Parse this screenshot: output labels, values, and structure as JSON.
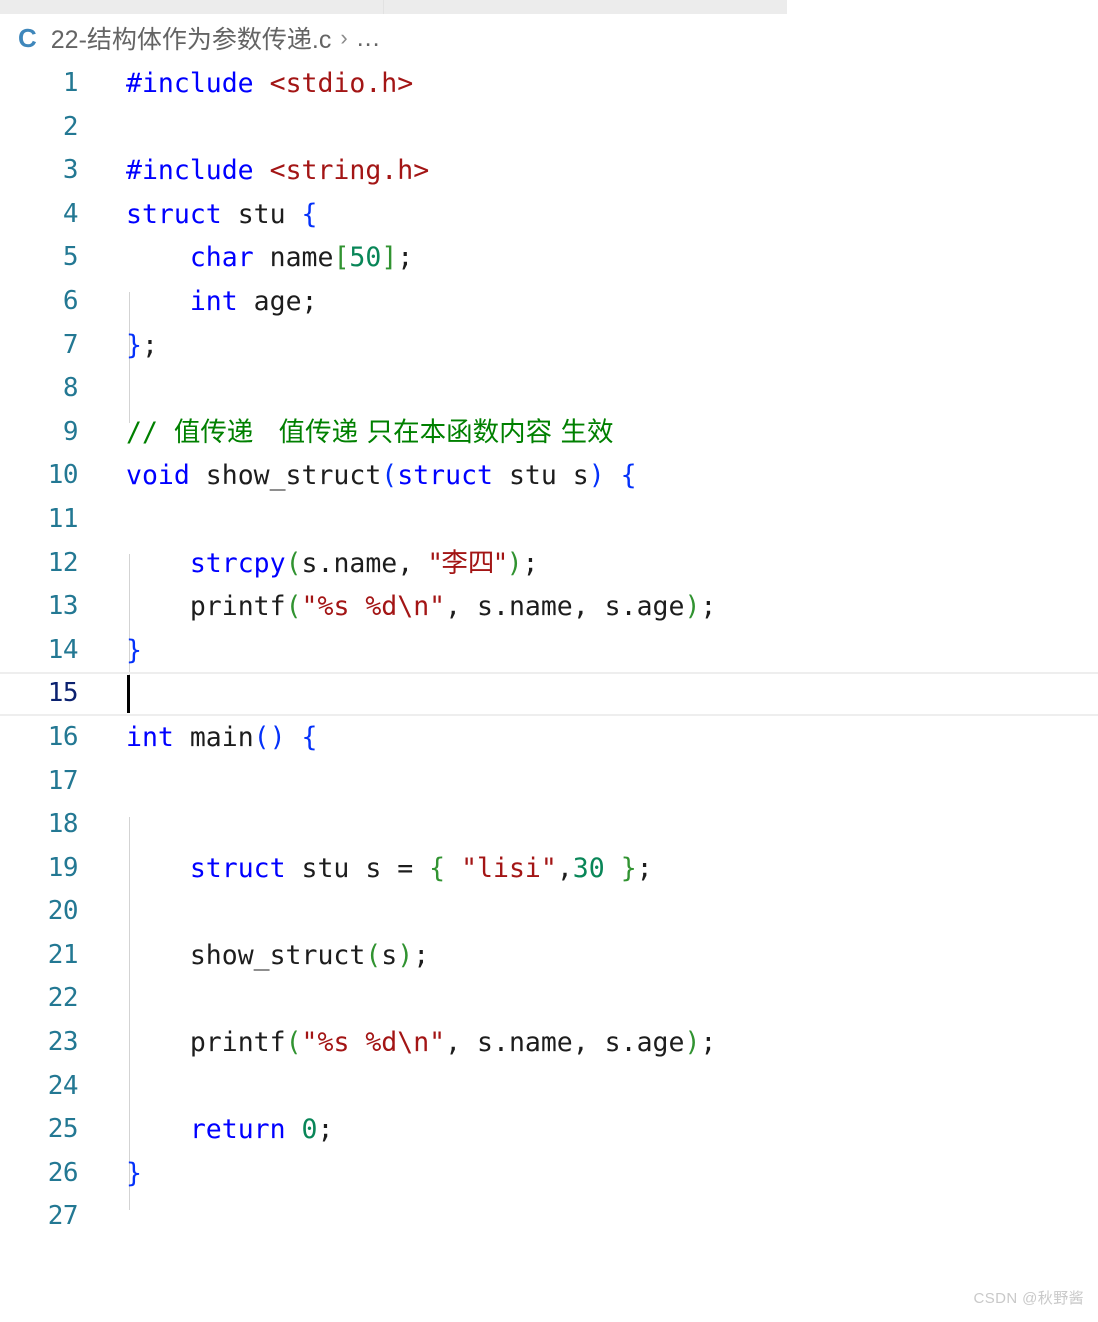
{
  "window": {
    "app": "code-editor",
    "theme": "light"
  },
  "tabstrip": {
    "visible": true
  },
  "breadcrumb": {
    "file_icon": "c-file-icon",
    "file_icon_label": "C",
    "file_name": "22-结构体作为参数传递.c",
    "separator": "›",
    "overflow": "..."
  },
  "editor": {
    "language": "c",
    "active_line": 15,
    "cursor": {
      "line": 15,
      "column": 1
    },
    "total_lines": 27,
    "lines": [
      {
        "n": "1",
        "tokens": [
          {
            "t": "#include",
            "c": "tk-pre"
          },
          {
            "t": " ",
            "c": "tk-plain"
          },
          {
            "t": "<stdio.h>",
            "c": "tk-str"
          }
        ]
      },
      {
        "n": "2",
        "tokens": []
      },
      {
        "n": "3",
        "tokens": [
          {
            "t": "#include",
            "c": "tk-pre"
          },
          {
            "t": " ",
            "c": "tk-plain"
          },
          {
            "t": "<string.h>",
            "c": "tk-str"
          }
        ]
      },
      {
        "n": "4",
        "tokens": [
          {
            "t": "struct",
            "c": "tk-key"
          },
          {
            "t": " stu ",
            "c": "tk-plain"
          },
          {
            "t": "{",
            "c": "tk-br1"
          }
        ]
      },
      {
        "n": "5",
        "tokens": [
          {
            "t": "    ",
            "c": "tk-plain"
          },
          {
            "t": "char",
            "c": "tk-key"
          },
          {
            "t": " name",
            "c": "tk-plain"
          },
          {
            "t": "[",
            "c": "tk-br2"
          },
          {
            "t": "50",
            "c": "tk-num"
          },
          {
            "t": "]",
            "c": "tk-br2"
          },
          {
            "t": ";",
            "c": "tk-plain"
          }
        ]
      },
      {
        "n": "6",
        "tokens": [
          {
            "t": "    ",
            "c": "tk-plain"
          },
          {
            "t": "int",
            "c": "tk-key"
          },
          {
            "t": " age;",
            "c": "tk-plain"
          }
        ]
      },
      {
        "n": "7",
        "tokens": [
          {
            "t": "}",
            "c": "tk-br1"
          },
          {
            "t": ";",
            "c": "tk-plain"
          }
        ]
      },
      {
        "n": "8",
        "tokens": []
      },
      {
        "n": "9",
        "tokens": [
          {
            "t": "// ",
            "c": "tk-cmt"
          },
          {
            "t": "值传递   值传递 只在本函数内容 生效",
            "c": "tk-cmt cjk"
          }
        ]
      },
      {
        "n": "10",
        "tokens": [
          {
            "t": "void",
            "c": "tk-key"
          },
          {
            "t": " show_struct",
            "c": "tk-fn"
          },
          {
            "t": "(",
            "c": "tk-br1"
          },
          {
            "t": "struct",
            "c": "tk-key"
          },
          {
            "t": " stu s",
            "c": "tk-plain"
          },
          {
            "t": ")",
            "c": "tk-br1"
          },
          {
            "t": " ",
            "c": "tk-plain"
          },
          {
            "t": "{",
            "c": "tk-br1"
          }
        ]
      },
      {
        "n": "11",
        "tokens": []
      },
      {
        "n": "12",
        "tokens": [
          {
            "t": "    ",
            "c": "tk-plain"
          },
          {
            "t": "strcpy",
            "c": "tk-fnblue"
          },
          {
            "t": "(",
            "c": "tk-br2"
          },
          {
            "t": "s.name, ",
            "c": "tk-plain"
          },
          {
            "t": "\"李四\"",
            "c": "tk-str cjk"
          },
          {
            "t": ")",
            "c": "tk-br2"
          },
          {
            "t": ";",
            "c": "tk-plain"
          }
        ]
      },
      {
        "n": "13",
        "tokens": [
          {
            "t": "    ",
            "c": "tk-plain"
          },
          {
            "t": "printf",
            "c": "tk-fn"
          },
          {
            "t": "(",
            "c": "tk-br2"
          },
          {
            "t": "\"%s %d\\n\"",
            "c": "tk-str"
          },
          {
            "t": ", s.name, s.age",
            "c": "tk-plain"
          },
          {
            "t": ")",
            "c": "tk-br2"
          },
          {
            "t": ";",
            "c": "tk-plain"
          }
        ]
      },
      {
        "n": "14",
        "tokens": [
          {
            "t": "}",
            "c": "tk-br1"
          }
        ]
      },
      {
        "n": "15",
        "tokens": []
      },
      {
        "n": "16",
        "tokens": [
          {
            "t": "int",
            "c": "tk-key"
          },
          {
            "t": " main",
            "c": "tk-fn"
          },
          {
            "t": "()",
            "c": "tk-br1"
          },
          {
            "t": " ",
            "c": "tk-plain"
          },
          {
            "t": "{",
            "c": "tk-br1"
          }
        ]
      },
      {
        "n": "17",
        "tokens": []
      },
      {
        "n": "18",
        "tokens": []
      },
      {
        "n": "19",
        "tokens": [
          {
            "t": "    ",
            "c": "tk-plain"
          },
          {
            "t": "struct",
            "c": "tk-key"
          },
          {
            "t": " stu s = ",
            "c": "tk-plain"
          },
          {
            "t": "{",
            "c": "tk-br2"
          },
          {
            "t": " ",
            "c": "tk-plain"
          },
          {
            "t": "\"lisi\"",
            "c": "tk-str"
          },
          {
            "t": ",",
            "c": "tk-plain"
          },
          {
            "t": "30",
            "c": "tk-num"
          },
          {
            "t": " ",
            "c": "tk-plain"
          },
          {
            "t": "}",
            "c": "tk-br2"
          },
          {
            "t": ";",
            "c": "tk-plain"
          }
        ]
      },
      {
        "n": "20",
        "tokens": []
      },
      {
        "n": "21",
        "tokens": [
          {
            "t": "    ",
            "c": "tk-plain"
          },
          {
            "t": "show_struct",
            "c": "tk-fn"
          },
          {
            "t": "(",
            "c": "tk-br2"
          },
          {
            "t": "s",
            "c": "tk-plain"
          },
          {
            "t": ")",
            "c": "tk-br2"
          },
          {
            "t": ";",
            "c": "tk-plain"
          }
        ]
      },
      {
        "n": "22",
        "tokens": []
      },
      {
        "n": "23",
        "tokens": [
          {
            "t": "    ",
            "c": "tk-plain"
          },
          {
            "t": "printf",
            "c": "tk-fn"
          },
          {
            "t": "(",
            "c": "tk-br2"
          },
          {
            "t": "\"%s %d\\n\"",
            "c": "tk-str"
          },
          {
            "t": ", s.name, s.age",
            "c": "tk-plain"
          },
          {
            "t": ")",
            "c": "tk-br2"
          },
          {
            "t": ";",
            "c": "tk-plain"
          }
        ]
      },
      {
        "n": "24",
        "tokens": []
      },
      {
        "n": "25",
        "tokens": [
          {
            "t": "    ",
            "c": "tk-plain"
          },
          {
            "t": "return",
            "c": "tk-key"
          },
          {
            "t": " ",
            "c": "tk-plain"
          },
          {
            "t": "0",
            "c": "tk-num"
          },
          {
            "t": ";",
            "c": "tk-plain"
          }
        ]
      },
      {
        "n": "26",
        "tokens": [
          {
            "t": "}",
            "c": "tk-br1"
          }
        ]
      },
      {
        "n": "27",
        "tokens": []
      }
    ]
  },
  "watermark": {
    "text": "CSDN @秋野酱"
  },
  "colors": {
    "background": "#ffffff",
    "tabstrip": "#ececec",
    "line_number": "#237893",
    "line_number_active": "#0b216f",
    "keyword": "#0000ff",
    "string": "#a31515",
    "number": "#098658",
    "comment": "#008000",
    "plain_text": "#1d1d1d",
    "bracket_level_1": "#0431fa",
    "bracket_level_2": "#319331",
    "indent_guide": "#d3d3d3",
    "breadcrumb_text": "#616161",
    "file_icon": "#3f87bb",
    "current_line_border": "#eeeeee",
    "caret": "#000000",
    "watermark": "#c9c9c9"
  }
}
